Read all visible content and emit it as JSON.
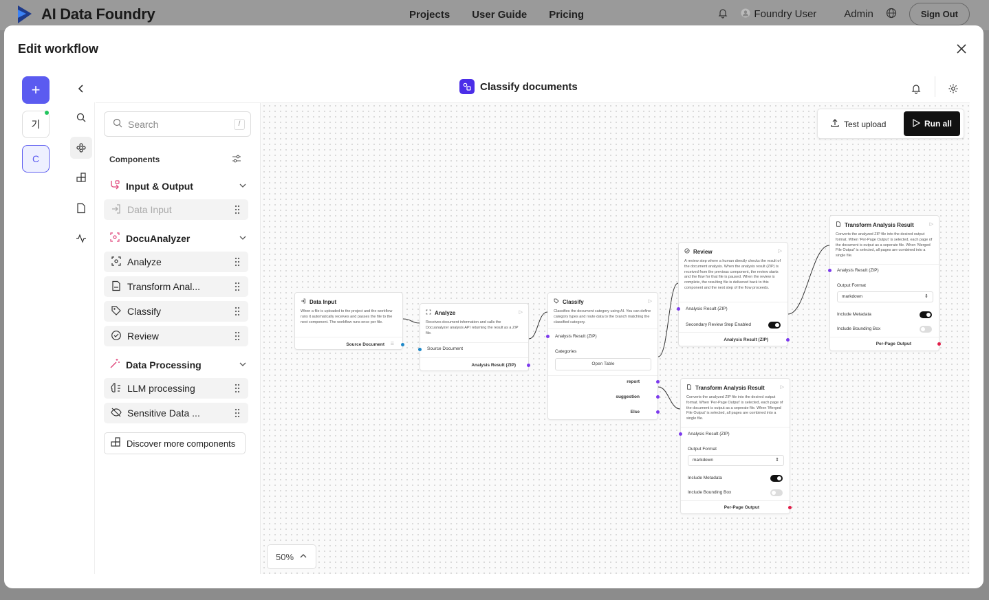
{
  "app": {
    "name": "AI Data Foundry"
  },
  "nav": {
    "projects": "Projects",
    "user_guide": "User Guide",
    "pricing": "Pricing"
  },
  "user": {
    "name": "Foundry User",
    "role": "Admin",
    "sign_out": "Sign Out"
  },
  "modal": {
    "title": "Edit workflow"
  },
  "rail": {
    "add": "+",
    "ko": "기",
    "c": "C"
  },
  "workflow": {
    "title": "Classify documents"
  },
  "panel": {
    "search_placeholder": "Search",
    "search_shortcut": "/",
    "components_label": "Components",
    "groups": [
      {
        "label": "Input & Output",
        "items": [
          "Data Input"
        ]
      },
      {
        "label": "DocuAnalyzer",
        "items": [
          "Analyze",
          "Transform Anal...",
          "Classify",
          "Review"
        ]
      },
      {
        "label": "Data Processing",
        "items": [
          "LLM processing",
          "Sensitive Data ..."
        ]
      }
    ],
    "discover": "Discover more components"
  },
  "canvas": {
    "test_upload": "Test upload",
    "run_all": "Run all",
    "zoom": "50%"
  },
  "nodes": {
    "data_input": {
      "title": "Data Input",
      "desc": "When a file is uploaded to the project and the workflow runs it automatically receives and passes the file to the next component. The workflow runs once per file.",
      "out": "Source Document"
    },
    "analyze": {
      "title": "Analyze",
      "desc": "Receives document information and calls the Docuanalyzer analysis API returning the result as a ZIP file.",
      "in": "Source Document",
      "out": "Analysis Result (ZIP)"
    },
    "classify": {
      "title": "Classify",
      "desc": "Classifies the document category using AI. You can define category types and route data to the branch matching the classified category.",
      "in": "Analysis Result (ZIP)",
      "categories": "Categories",
      "open_table": "Open Table",
      "outs": [
        "report",
        "suggestion",
        "Else"
      ]
    },
    "review": {
      "title": "Review",
      "desc": "A review step where a human directly checks the result of the document analysis. When the analysis result (ZIP) is received from the previous component, the review starts and the flow for that file is paused. When the review is complete, the resulting file is delivered back to this component and the next step of the flow proceeds.",
      "in": "Analysis Result (ZIP)",
      "secondary": "Secondary Review Step Enabled",
      "out": "Analysis Result (ZIP)"
    },
    "transform_top": {
      "title": "Transform Analysis Result",
      "desc": "Converts the analyzed ZIP file into the desired output format. When 'Per-Page Output' is selected, each page of the document is output as a seperate file. When 'Merged File Output' is selected, all pages are combined into a single file.",
      "in": "Analysis Result (ZIP)",
      "output_format": "Output Format",
      "format_value": "markdown",
      "metadata": "Include Metadata",
      "bbox": "Include Bounding Box",
      "out": "Per-Page Output"
    },
    "transform_bottom": {
      "title": "Transform Analysis Result",
      "desc": "Converts the analyzed ZIP file into the desired output format. When 'Per-Page Output' is selected, each page of the document is output as a seperate file. When 'Merged File Output' is selected, all pages are combined into a single file.",
      "in": "Analysis Result (ZIP)",
      "output_format": "Output Format",
      "format_value": "markdown",
      "metadata": "Include Metadata",
      "bbox": "Include Bounding Box",
      "out": "Per-Page Output"
    }
  },
  "colors": {
    "accent": "#5b5bf0",
    "port_blue": "#1e88c8",
    "port_purple": "#7c3aed",
    "port_red": "#e11d48"
  }
}
